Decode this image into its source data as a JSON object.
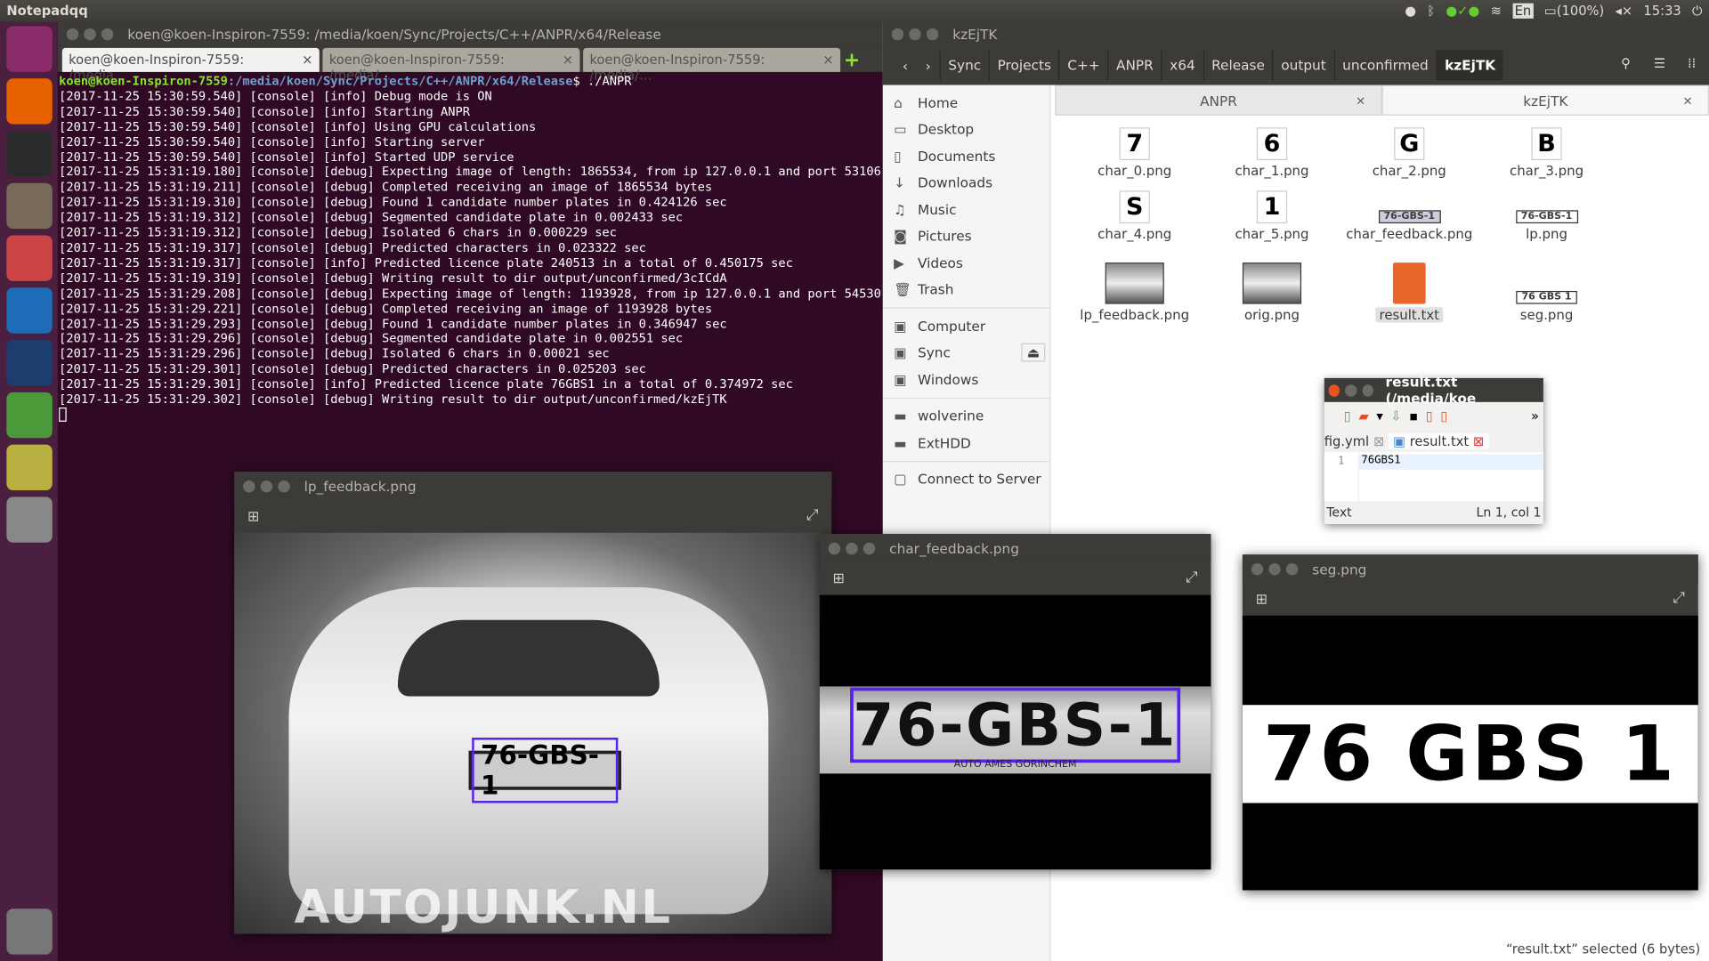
{
  "topbar": {
    "app_name": "Notepadqq",
    "keyboard": "En",
    "battery": "(100%)",
    "clock": "15:33"
  },
  "launcher": [
    "ubuntu-icon",
    "firefox-icon",
    "terminal-icon",
    "files-icon",
    "settings-icon",
    "vscode-icon",
    "lock-icon",
    "notepadqq-icon",
    "image-viewer-icon",
    "disk-icon",
    "trash-icon"
  ],
  "terminal": {
    "title": "koen@koen-Inspiron-7559: /media/koen/Sync/Projects/C++/ANPR/x64/Release",
    "tabs": [
      "koen@koen-Inspiron-7559: /media...",
      "koen@koen-Inspiron-7559: /media/...",
      "koen@koen-Inspiron-7559: /media/..."
    ],
    "prompt_user": "koen@koen-Inspiron-7559",
    "prompt_path": ":/media/koen/Sync/Projects/C++/ANPR/x64/Release",
    "command": "$ ./ANPR",
    "lines": [
      "[2017-11-25 15:30:59.540] [console] [info] Debug mode is ON",
      "[2017-11-25 15:30:59.540] [console] [info] Starting ANPR",
      "[2017-11-25 15:30:59.540] [console] [info] Using GPU calculations",
      "[2017-11-25 15:30:59.540] [console] [info] Starting server",
      "[2017-11-25 15:30:59.540] [console] [info] Started UDP service",
      "[2017-11-25 15:31:19.180] [console] [debug] Expecting image of length: 1865534, from ip 127.0.0.1 and port 53106",
      "[2017-11-25 15:31:19.211] [console] [debug] Completed receiving an image of 1865534 bytes",
      "[2017-11-25 15:31:19.310] [console] [debug] Found 1 candidate number plates in 0.424126 sec",
      "[2017-11-25 15:31:19.312] [console] [debug] Segmented candidate plate in 0.002433 sec",
      "[2017-11-25 15:31:19.312] [console] [debug] Isolated 6 chars in 0.000229 sec",
      "[2017-11-25 15:31:19.317] [console] [debug] Predicted characters in 0.023322 sec",
      "[2017-11-25 15:31:19.317] [console] [info] Predicted licence plate 240513 in a total of 0.450175 sec",
      "[2017-11-25 15:31:19.319] [console] [debug] Writing result to dir output/unconfirmed/3cICdA",
      "[2017-11-25 15:31:29.208] [console] [debug] Expecting image of length: 1193928, from ip 127.0.0.1 and port 54530",
      "[2017-11-25 15:31:29.221] [console] [debug] Completed receiving an image of 1193928 bytes",
      "[2017-11-25 15:31:29.293] [console] [debug] Found 1 candidate number plates in 0.346947 sec",
      "[2017-11-25 15:31:29.296] [console] [debug] Segmented candidate plate in 0.002551 sec",
      "[2017-11-25 15:31:29.296] [console] [debug] Isolated 6 chars in 0.00021 sec",
      "[2017-11-25 15:31:29.301] [console] [debug] Predicted characters in 0.025203 sec",
      "[2017-11-25 15:31:29.301] [console] [info] Predicted licence plate 76GBS1 in a total of 0.374972 sec",
      "[2017-11-25 15:31:29.302] [console] [debug] Writing result to dir output/unconfirmed/kzEjTK"
    ]
  },
  "files": {
    "title": "kzEjTK",
    "breadcrumbs": [
      "Sync",
      "Projects",
      "C++",
      "ANPR",
      "x64",
      "Release",
      "output",
      "unconfirmed",
      "kzEjTK"
    ],
    "sidebar": [
      {
        "icon": "home-icon",
        "glyph": "⌂",
        "label": "Home"
      },
      {
        "icon": "desktop-icon",
        "glyph": "▭",
        "label": "Desktop"
      },
      {
        "icon": "documents-icon",
        "glyph": "▯",
        "label": "Documents"
      },
      {
        "icon": "downloads-icon",
        "glyph": "↓",
        "label": "Downloads"
      },
      {
        "icon": "music-icon",
        "glyph": "♫",
        "label": "Music"
      },
      {
        "icon": "pictures-icon",
        "glyph": "◙",
        "label": "Pictures"
      },
      {
        "icon": "videos-icon",
        "glyph": "▶",
        "label": "Videos"
      },
      {
        "icon": "trash-icon",
        "glyph": "🗑",
        "label": "Trash"
      },
      {
        "icon": "computer-icon",
        "glyph": "▣",
        "label": "Computer"
      },
      {
        "icon": "drive-icon",
        "glyph": "▣",
        "label": "Sync"
      },
      {
        "icon": "drive-icon",
        "glyph": "▣",
        "label": "Windows"
      },
      {
        "icon": "folder-icon",
        "glyph": "▬",
        "label": "wolverine"
      },
      {
        "icon": "folder-icon",
        "glyph": "▬",
        "label": "ExtHDD"
      },
      {
        "icon": "server-icon",
        "glyph": "▢",
        "label": "Connect to Server"
      }
    ],
    "tabs": [
      "ANPR",
      "kzEjTK"
    ],
    "items": [
      {
        "name": "char_0.png",
        "glyph": "7"
      },
      {
        "name": "char_1.png",
        "glyph": "6"
      },
      {
        "name": "char_2.png",
        "glyph": "G"
      },
      {
        "name": "char_3.png",
        "glyph": "B"
      },
      {
        "name": "char_4.png",
        "glyph": "S"
      },
      {
        "name": "char_5.png",
        "glyph": "1"
      },
      {
        "name": "char_feedback.png",
        "glyph": "76-GBS-1"
      },
      {
        "name": "lp.png",
        "glyph": "76-GBS-1"
      },
      {
        "name": "lp_feedback.png",
        "glyph": ""
      },
      {
        "name": "orig.png",
        "glyph": ""
      },
      {
        "name": "result.txt",
        "glyph": ""
      },
      {
        "name": "seg.png",
        "glyph": "76 GBS 1"
      }
    ],
    "status": "“result.txt” selected  (6 bytes)"
  },
  "viewers": {
    "lp": {
      "title": "lp_feedback.png",
      "plate": "76-GBS-1",
      "watermark": "AUTOJUNK.NL"
    },
    "char": {
      "title": "char_feedback.png",
      "plate": "76-GBS-1",
      "subtext": "AUTO AMES GORINCHEM"
    },
    "seg": {
      "title": "seg.png",
      "plate": "76 GBS 1"
    }
  },
  "editor": {
    "title": "result.txt (/media/koe",
    "tab_prev": "fig.yml",
    "tab_active": "result.txt",
    "line_no": "1",
    "content": "76GBS1",
    "mode": "Text",
    "position": "Ln 1, col 1"
  },
  "colors": {
    "terminal_bg": "#300a24",
    "box_outline": "#5522ee"
  }
}
